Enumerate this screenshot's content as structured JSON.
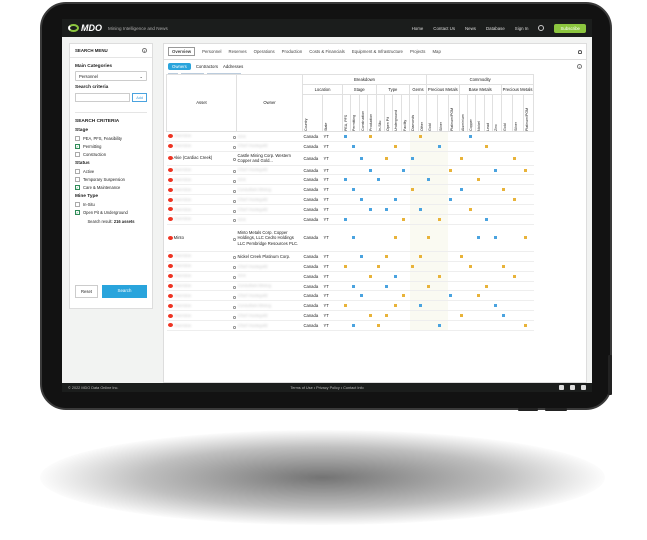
{
  "header": {
    "logo": "MDO",
    "tagline": "Mining Intelligence and News",
    "nav": [
      "Home",
      "Contact Us",
      "News",
      "Database",
      "Sign In"
    ],
    "subscribe": "Subscribe"
  },
  "sidebar": {
    "title": "SEARCH MENU",
    "main_categories_label": "Main Categories",
    "category": "Personnel",
    "criteria_label": "Search criteria",
    "add": "Add",
    "search_criteria_title": "SEARCH CRITERIA",
    "stage_title": "Stage",
    "stage": [
      {
        "label": "PEA, PFS, Feasibility",
        "checked": false
      },
      {
        "label": "Permitting",
        "checked": true
      },
      {
        "label": "Construction",
        "checked": false
      }
    ],
    "status_title": "Status",
    "status": [
      {
        "label": "Active",
        "checked": false
      },
      {
        "label": "Temporary Suspension",
        "checked": false
      },
      {
        "label": "Care & Maintenance",
        "checked": true
      }
    ],
    "mine_type_title": "Mine Type",
    "mine_type": [
      {
        "label": "In-Situ",
        "checked": false
      },
      {
        "label": "Open Pit & Underground",
        "checked": true
      }
    ],
    "result": "Search result:",
    "result_count": "216 assets",
    "reset": "Reset",
    "search": "Search"
  },
  "main": {
    "tabs": [
      "Overview",
      "Personnel",
      "Reserves",
      "Operations",
      "Production",
      "Costs & Financials",
      "Equipment & Infrastructure",
      "Projects",
      "Map"
    ],
    "subtabs": [
      "Owners",
      "Contractors",
      "Addresses"
    ],
    "year": "2022",
    "commodity_ctrl": "Commodity",
    "col_asset": "Asset",
    "col_owner": "Owner",
    "col_breakdown": "Breakdown",
    "col_commodity": "Commodity",
    "col_location": "Location",
    "col_stage": "Stage",
    "col_type": "Type",
    "col_gems": "Gems",
    "col_precious": "Precious Metals",
    "col_base": "Base Metals",
    "col_precious2": "Precious Metals",
    "sub_cols": [
      "Country",
      "State",
      "PEA, PFS",
      "Permitting",
      "Construction",
      "Production",
      "In-Situ",
      "Open Pit",
      "Underground",
      "Facility",
      "Diamonds",
      "Other",
      "Gold",
      "Silver",
      "Platinum/PGM",
      "Aluminium",
      "Copper",
      "Nickel",
      "Lead",
      "Zinc",
      "Gold",
      "Silver",
      "Platinum/PGM"
    ],
    "rows": [
      {
        "asset": "Overview",
        "owner": "XXX",
        "country": "Canada",
        "state": "YT"
      },
      {
        "asset": "Overview",
        "owner": "Chief Hootsgold",
        "country": "Canada",
        "state": "YT"
      },
      {
        "asset": "Akie (Cardiac Creek)",
        "owner": "Castle Mining Corp. Western Copper and Gold...",
        "country": "Canada",
        "state": "YT"
      },
      {
        "asset": "Overview",
        "owner": "Chief Hootsgold",
        "country": "Canada",
        "state": "YT"
      },
      {
        "asset": "Overview",
        "owner": "XXX",
        "country": "Canada",
        "state": "YT"
      },
      {
        "asset": "Overview",
        "owner": "Consultant Mining",
        "country": "Canada",
        "state": "YT"
      },
      {
        "asset": "Overview",
        "owner": "Chief Hootsgold",
        "country": "Canada",
        "state": "YT"
      },
      {
        "asset": "Overview",
        "owner": "Chief Hootsgold",
        "country": "Canada",
        "state": "YT"
      },
      {
        "asset": "Overview",
        "owner": "XXX",
        "country": "Canada",
        "state": "YT"
      },
      {
        "asset": "Minto",
        "owner": "Minto Metals Corp. Copper Holdings, LLC Cedro Holdings LLC Pembridge Resources PLC.",
        "country": "Canada",
        "state": "YT"
      },
      {
        "asset": "Overview",
        "owner": "Nickel Creek Platinum Corp.",
        "country": "Canada",
        "state": "YT"
      },
      {
        "asset": "Overview",
        "owner": "Chief Hootsgold",
        "country": "Canada",
        "state": "YT"
      },
      {
        "asset": "Overview",
        "owner": "XXX",
        "country": "Canada",
        "state": "YT"
      },
      {
        "asset": "Overview",
        "owner": "Consultant Mining",
        "country": "Canada",
        "state": "YT"
      },
      {
        "asset": "Overview",
        "owner": "Chief Hootsgold",
        "country": "Canada",
        "state": "YT"
      },
      {
        "asset": "Overview",
        "owner": "Consultant Mining",
        "country": "Canada",
        "state": "YT"
      },
      {
        "asset": "Overview",
        "owner": "Chief Hootsgold",
        "country": "Canada",
        "state": "YT"
      },
      {
        "asset": "Overview",
        "owner": "Chief Hootsgold",
        "country": "Canada",
        "state": "YT"
      }
    ]
  },
  "footer": {
    "copyright": "© 2022 MDO Data Online Inc.",
    "links": "Terms of Use • Privacy Policy • Contact Info"
  }
}
